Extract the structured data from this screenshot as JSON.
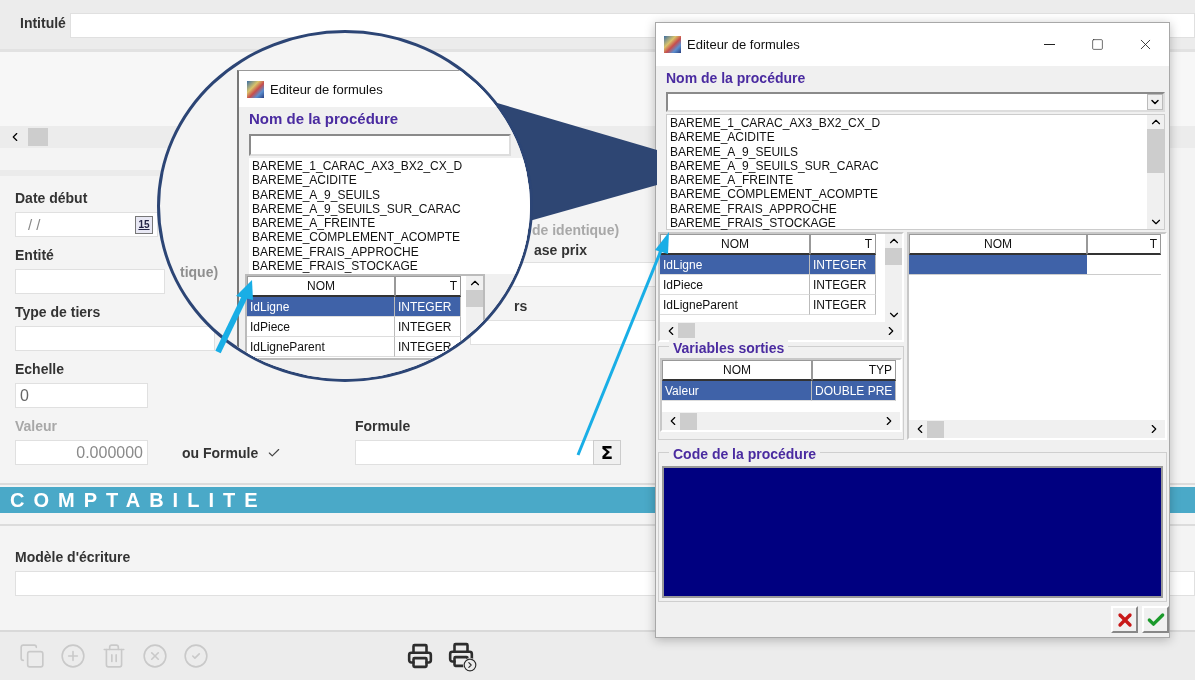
{
  "form": {
    "intitule": {
      "label": "Intitulé"
    },
    "date_debut": {
      "label": "Date début",
      "value": "/ /",
      "calendar_day": "15"
    },
    "entite": {
      "label": "Entité"
    },
    "type_tiers": {
      "label": "Type de tiers"
    },
    "side_fragments": {
      "note": "de identique)",
      "label_top": "ase prix",
      "label_bottom": "rs"
    },
    "echelle": {
      "label": "Echelle",
      "value": "0"
    },
    "valeur": {
      "label": "Valeur",
      "value": "0.000000",
      "disabled": true
    },
    "ou_formule": {
      "label": "ou Formule",
      "checked": true
    },
    "formule": {
      "label": "Formule",
      "button": "Σ"
    },
    "section_title": "COMPTABILITE",
    "modele_ecriture": {
      "label": "Modèle d'écriture"
    },
    "toolbar": [
      {
        "kind": "copy",
        "disabled": true
      },
      {
        "kind": "add",
        "disabled": true
      },
      {
        "kind": "delete",
        "disabled": true
      },
      {
        "kind": "cancel",
        "disabled": true
      },
      {
        "kind": "validate",
        "disabled": true
      },
      {
        "kind": "print",
        "disabled": false
      },
      {
        "kind": "print-export",
        "disabled": false
      }
    ]
  },
  "dialog": {
    "title": "Editeur de formules",
    "procedure_label": "Nom de la procédure",
    "procedures": [
      "BAREME_1_CARAC_AX3_BX2_CX_D",
      "BAREME_ACIDITE",
      "BAREME_A_9_SEUILS",
      "BAREME_A_9_SEUILS_SUR_CARAC",
      "BAREME_A_FREINTE",
      "BAREME_COMPLEMENT_ACOMPTE",
      "BAREME_FRAIS_APPROCHE",
      "BAREME_FRAIS_STOCKAGE"
    ],
    "inputs_table": {
      "columns": [
        "NOM",
        "T"
      ],
      "rows": [
        {
          "cells": [
            "IdLigne",
            "INTEGER"
          ],
          "selected": true
        },
        {
          "cells": [
            "IdPiece",
            "INTEGER"
          ],
          "selected": false
        },
        {
          "cells": [
            "IdLigneParent",
            "INTEGER"
          ],
          "selected": false
        }
      ]
    },
    "outputs": {
      "title": "Variables sorties",
      "columns": [
        "NOM",
        "TYP"
      ],
      "rows": [
        {
          "cells": [
            "Valeur",
            "DOUBLE PRE"
          ],
          "selected": true
        }
      ]
    },
    "right_table": {
      "columns": [
        "NOM",
        "T"
      ],
      "rows": [
        {
          "selected": true
        }
      ]
    },
    "code_title": "Code de la procédure"
  },
  "magnifier": {
    "background_fragment": "tique)",
    "title": "Editeur de formules",
    "procedure_label": "Nom de la procédure",
    "procedures": [
      "BAREME_1_CARAC_AX3_BX2_CX_D",
      "BAREME_ACIDITE",
      "BAREME_A_9_SEUILS",
      "BAREME_A_9_SEUILS_SUR_CARAC",
      "BAREME_A_FREINTE",
      "BAREME_COMPLEMENT_ACOMPTE",
      "BAREME_FRAIS_APPROCHE",
      "BAREME_FRAIS_STOCKAGE"
    ],
    "table": {
      "columns": [
        "NOM",
        "T"
      ],
      "rows": [
        {
          "cells": [
            "IdLigne",
            "INTEGER"
          ],
          "selected": true
        },
        {
          "cells": [
            "IdPiece",
            "INTEGER"
          ],
          "selected": false
        },
        {
          "cells": [
            "IdLigneParent",
            "INTEGER"
          ],
          "selected": false
        }
      ]
    }
  }
}
